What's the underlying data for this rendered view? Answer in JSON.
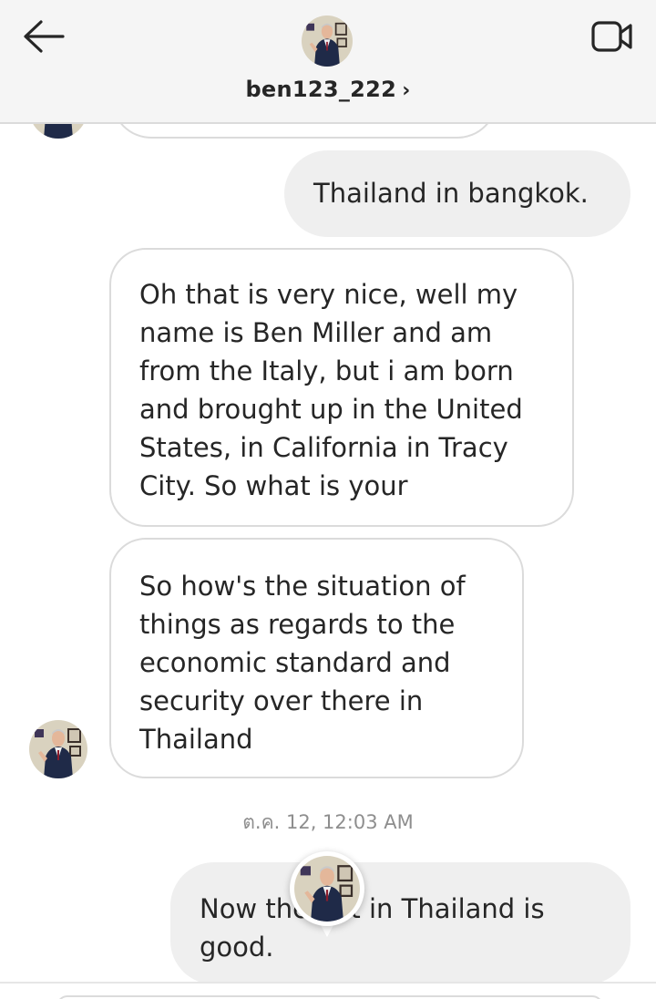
{
  "header": {
    "username": "ben123_222",
    "chevron": "›",
    "icons": {
      "back": "arrow-left-icon",
      "video": "video-camera-icon",
      "avatar": "profile-photo"
    }
  },
  "messages": {
    "out_1": "Thailand in bangkok.",
    "in_1": "Oh that is very nice, well my name is Ben Miller and am from the Italy, but i am born and brought up in the United States, in California in Tracy City. So what is your",
    "in_2": "So how's the situation of things as regards to the economic standard and security over there in Thailand",
    "timestamp": "ต.ค. 12, 12:03 AM",
    "out_2_line1": "Now the ent in Thailand is",
    "out_2_line2": "good."
  },
  "colors": {
    "header_bg": "#f5f5f5",
    "incoming_border": "#dbdbdb",
    "outgoing_bg": "#efefef",
    "text": "#262626",
    "muted": "#8e8e8e"
  }
}
